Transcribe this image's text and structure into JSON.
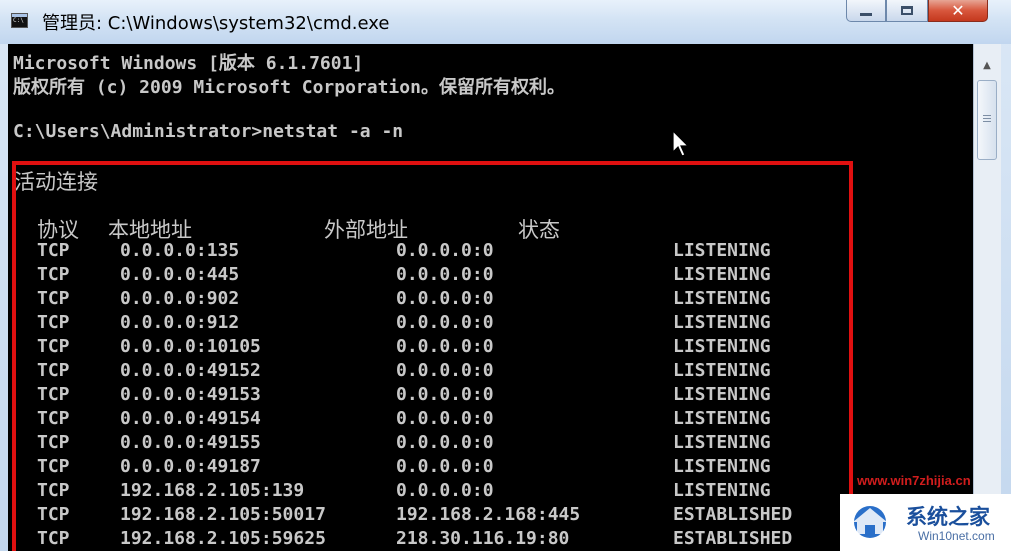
{
  "window": {
    "title": "管理员: C:\\Windows\\system32\\cmd.exe",
    "close_glyph": "✕"
  },
  "console": {
    "line1": "Microsoft Windows [版本 6.1.7601]",
    "line2": "版权所有 (c) 2009 Microsoft Corporation。保留所有权利。",
    "prompt": "C:\\Users\\Administrator>netstat -a -n",
    "section_title": "活动连接",
    "headers": {
      "protocol": "协议",
      "local": "本地地址",
      "foreign": "外部地址",
      "state": "状态"
    },
    "connections": [
      {
        "proto": "TCP",
        "local": "0.0.0.0:135",
        "foreign": "0.0.0.0:0",
        "state": "LISTENING"
      },
      {
        "proto": "TCP",
        "local": "0.0.0.0:445",
        "foreign": "0.0.0.0:0",
        "state": "LISTENING"
      },
      {
        "proto": "TCP",
        "local": "0.0.0.0:902",
        "foreign": "0.0.0.0:0",
        "state": "LISTENING"
      },
      {
        "proto": "TCP",
        "local": "0.0.0.0:912",
        "foreign": "0.0.0.0:0",
        "state": "LISTENING"
      },
      {
        "proto": "TCP",
        "local": "0.0.0.0:10105",
        "foreign": "0.0.0.0:0",
        "state": "LISTENING"
      },
      {
        "proto": "TCP",
        "local": "0.0.0.0:49152",
        "foreign": "0.0.0.0:0",
        "state": "LISTENING"
      },
      {
        "proto": "TCP",
        "local": "0.0.0.0:49153",
        "foreign": "0.0.0.0:0",
        "state": "LISTENING"
      },
      {
        "proto": "TCP",
        "local": "0.0.0.0:49154",
        "foreign": "0.0.0.0:0",
        "state": "LISTENING"
      },
      {
        "proto": "TCP",
        "local": "0.0.0.0:49155",
        "foreign": "0.0.0.0:0",
        "state": "LISTENING"
      },
      {
        "proto": "TCP",
        "local": "0.0.0.0:49187",
        "foreign": "0.0.0.0:0",
        "state": "LISTENING"
      },
      {
        "proto": "TCP",
        "local": "192.168.2.105:139",
        "foreign": "0.0.0.0:0",
        "state": "LISTENING"
      },
      {
        "proto": "TCP",
        "local": "192.168.2.105:50017",
        "foreign": "192.168.2.168:445",
        "state": "ESTABLISHED"
      },
      {
        "proto": "TCP",
        "local": "192.168.2.105:59625",
        "foreign": "218.30.116.19:80",
        "state": "ESTABLISHED"
      }
    ]
  },
  "watermark": {
    "url": "www.win7zhijia.cn",
    "name": "系统之家",
    "domain": "Win10net.com"
  },
  "colors": {
    "console_bg": "#000000",
    "console_text": "#c8c8c8",
    "highlight_border": "#e01010"
  }
}
